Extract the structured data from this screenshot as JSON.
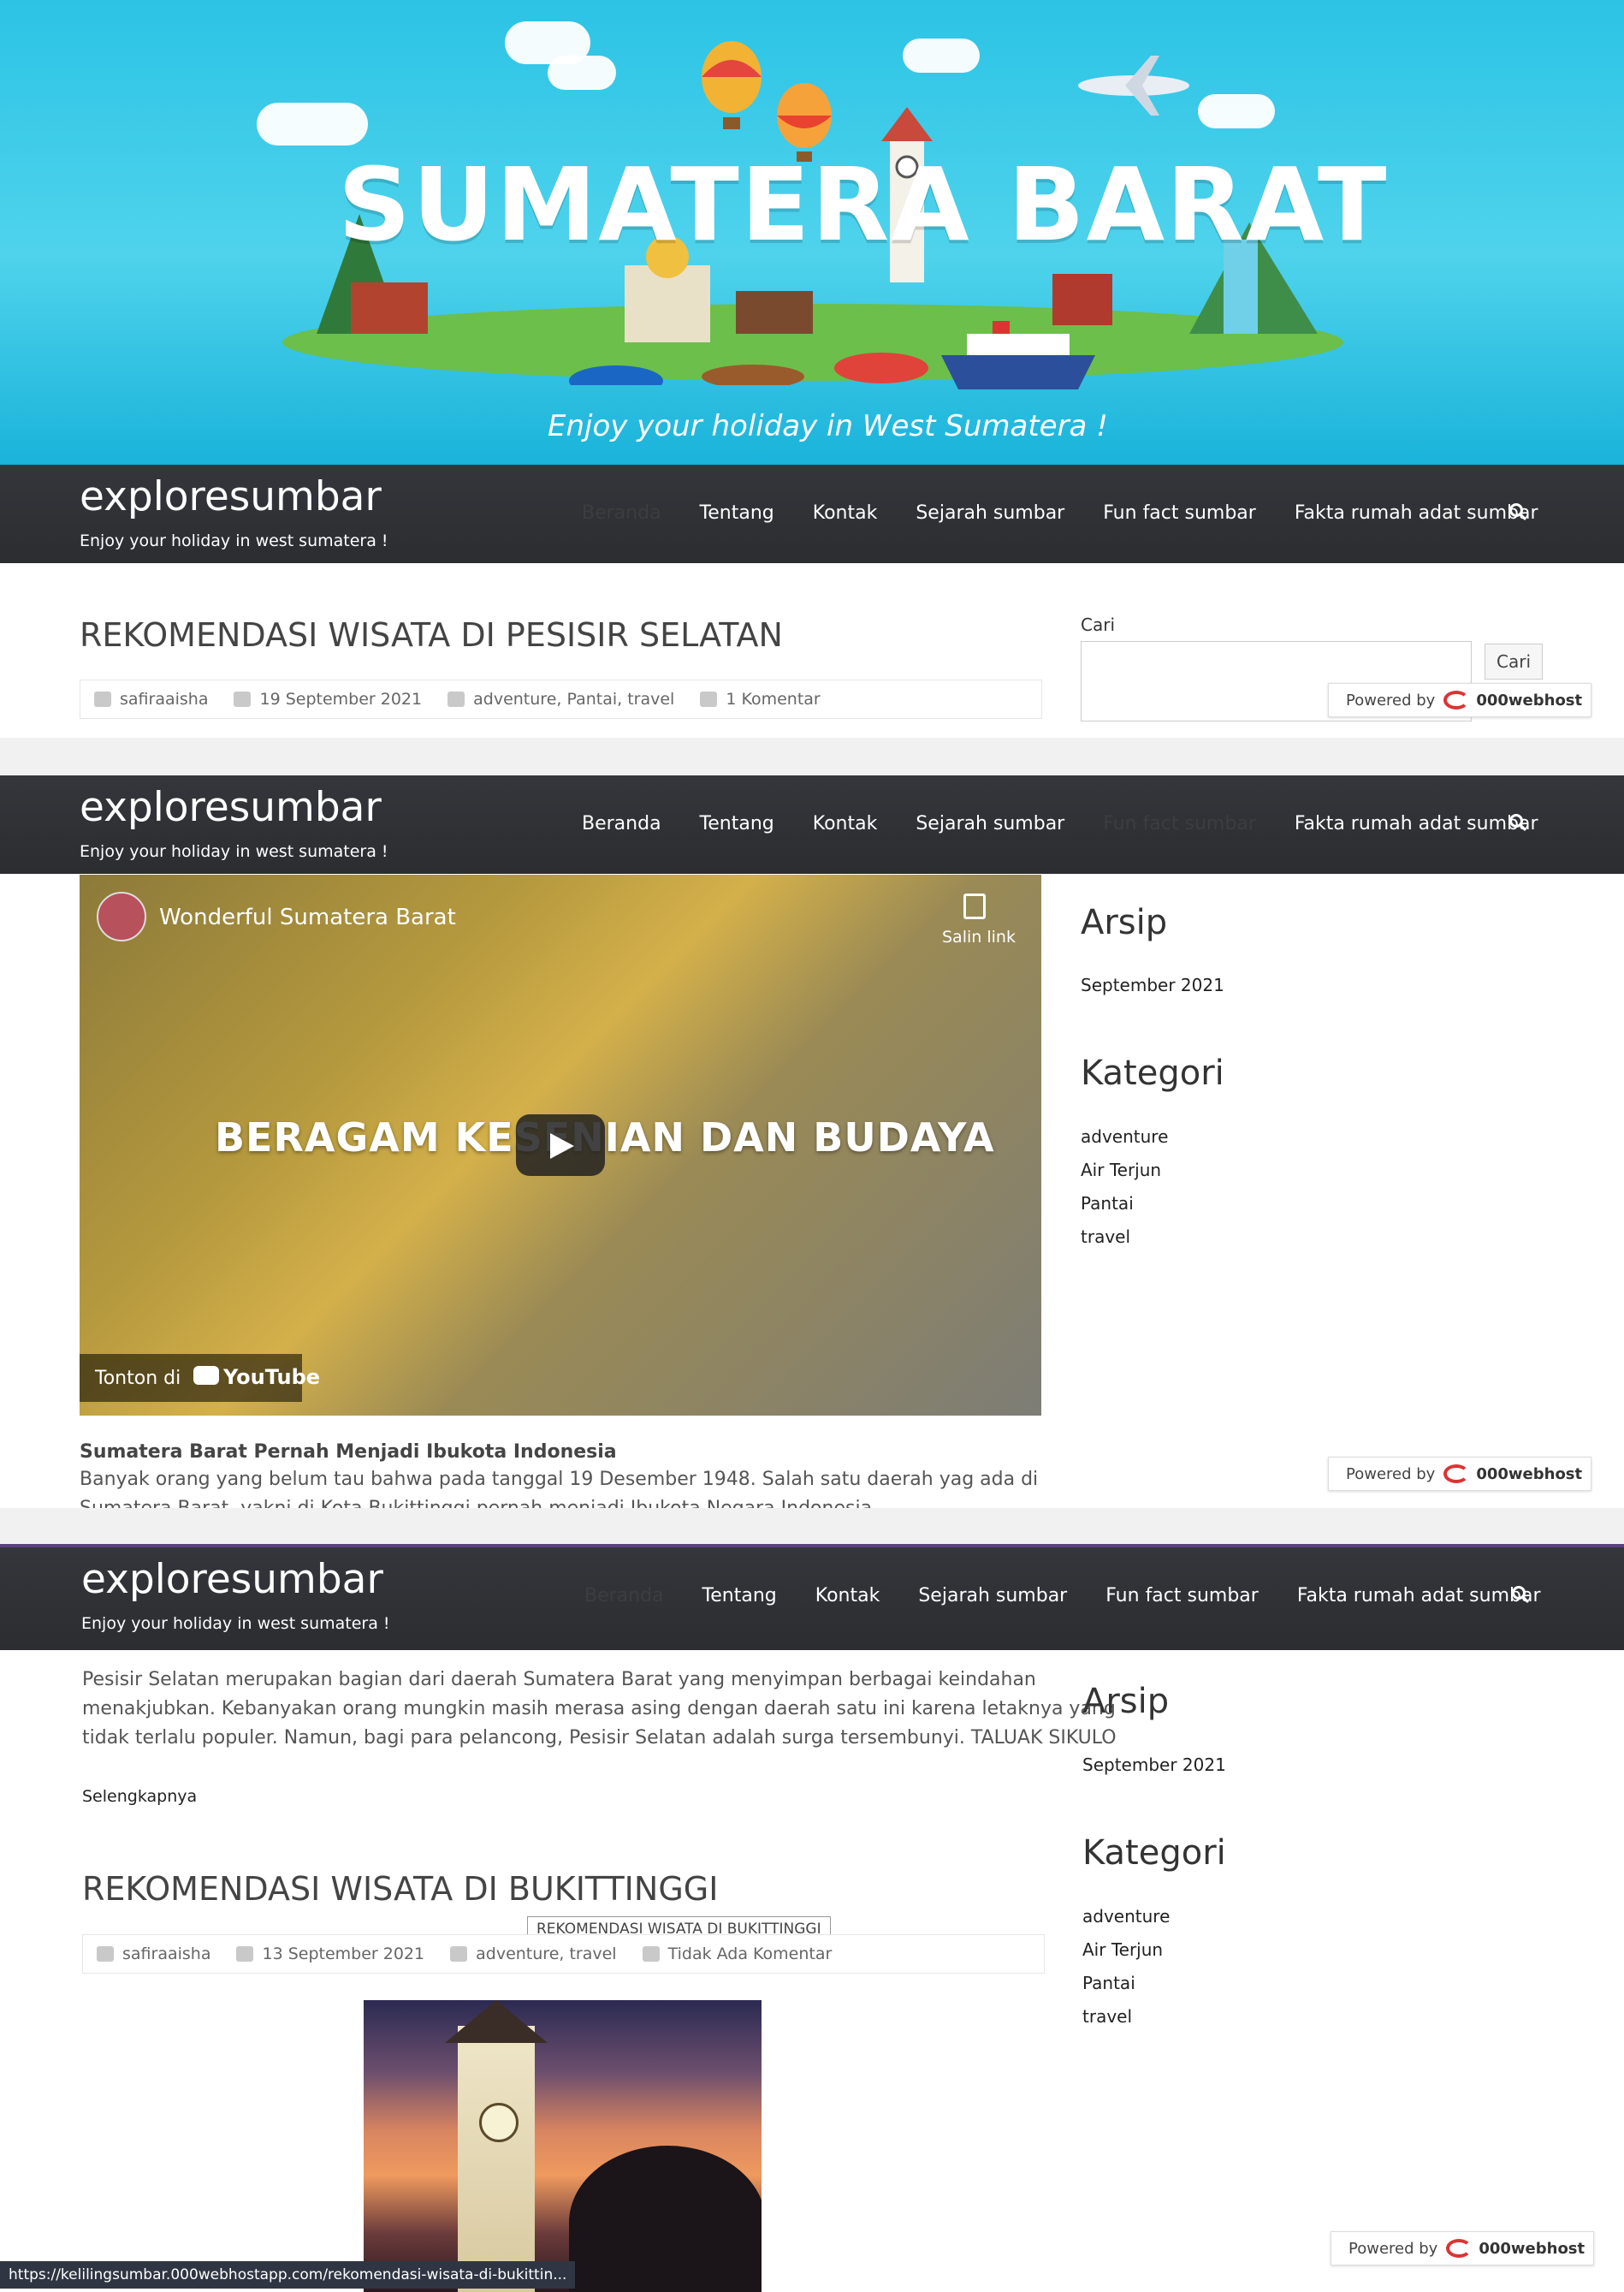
{
  "hero": {
    "title": "SUMATERA BARAT",
    "tagline": "Enjoy your holiday in West Sumatera !"
  },
  "site": {
    "brand": "exploresumbar",
    "tagline": "Enjoy your holiday in west sumatera !"
  },
  "nav": {
    "items": [
      "Beranda",
      "Tentang",
      "Kontak",
      "Sejarah sumbar",
      "Fun fact sumbar",
      "Fakta rumah adat sumbar"
    ]
  },
  "post1": {
    "title": "REKOMENDASI WISATA DI PESISIR SELATAN",
    "author": "safiraaisha",
    "date": "19 September 2021",
    "categories": "adventure, Pantai, travel",
    "comments": "1 Komentar"
  },
  "search": {
    "label": "Cari",
    "button": "Cari"
  },
  "powered": {
    "label": "Powered by",
    "host": "000webhost"
  },
  "video": {
    "title": "Wonderful Sumatera Barat",
    "copy_label": "Salin link",
    "overlay": "BERAGAM KESENIAN DAN BUDAYA",
    "watch_on": "Tonton di",
    "youtube": "YouTube"
  },
  "sidebar": {
    "archive_heading": "Arsip",
    "archive_item": "September 2021",
    "category_heading": "Kategori",
    "categories": [
      "adventure",
      "Air Terjun",
      "Pantai",
      "travel"
    ]
  },
  "article": {
    "subheading": "Sumatera Barat  Pernah Menjadi Ibukota Indonesia",
    "line1": "Banyak orang yang belum tau bahwa pada tanggal 19 Desember 1948. Salah satu daerah yag ada di",
    "line2": "Sumatera Barat, yakni di Kota Bukittinggi pernah menjadi Ibukota Negara Indonesia.",
    "excerpt1": "Pesisir Selatan merupakan bagian dari daerah Sumatera Barat yang menyimpan berbagai keindahan",
    "excerpt2": "menakjubkan. Kebanyakan orang mungkin masih merasa asing dengan daerah satu ini karena letaknya yang",
    "excerpt3": "tidak terlalu populer. Namun, bagi para pelancong, Pesisir Selatan adalah surga tersembunyi. TALUAK SIKULO",
    "read_more": "Selengkapnya"
  },
  "post2": {
    "title": "REKOMENDASI WISATA DI BUKITTINGGI",
    "author": "safiraaisha",
    "date": "13 September 2021",
    "categories": "adventure, travel",
    "comments": "Tidak Ada Komentar",
    "tooltip": "REKOMENDASI WISATA DI BUKITTINGGI"
  },
  "status_url": "https://kelilingsumbar.000webhostapp.com/rekomendasi-wisata-di-bukittin..."
}
